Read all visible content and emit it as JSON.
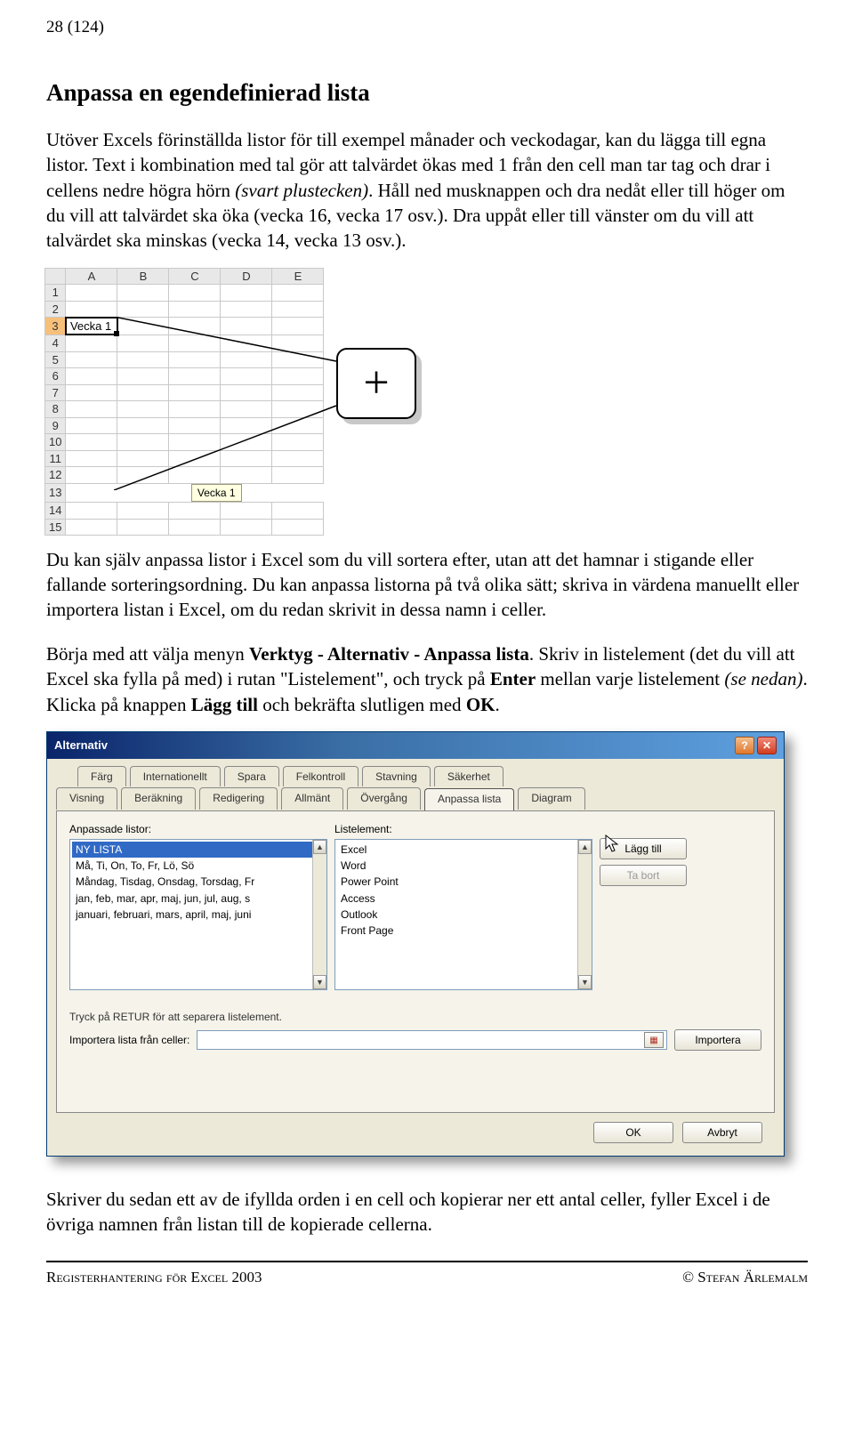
{
  "page_num": "28 (124)",
  "heading": "Anpassa en egendefinierad lista",
  "para1_a": "Utöver Excels förinställda listor för till exempel månader och veckodagar, kan du lägga till egna listor. Text i kombination med tal gör att talvärdet ökas med 1 från den cell man tar tag och drar i cellens nedre högra hörn ",
  "para1_b": "(svart plustecken)",
  "para1_c": ". Håll ned musknappen och dra nedåt eller till höger om du vill att talvärdet ska öka (vecka 16, vecka 17 osv.). Dra uppåt eller till vänster om du vill att talvärdet ska minskas (vecka 14, vecka 13 osv.).",
  "excel": {
    "cols": [
      "A",
      "B",
      "C",
      "D",
      "E"
    ],
    "rows": [
      "1",
      "2",
      "3",
      "4",
      "5",
      "6",
      "7",
      "8",
      "9",
      "10",
      "11",
      "12",
      "13",
      "14",
      "15"
    ],
    "cell_A3": "Vecka 1",
    "tooltip": "Vecka 1"
  },
  "plus": "+",
  "para2": "Du kan själv anpassa listor i Excel som du vill sortera efter, utan att det hamnar i stigande eller fallande sorteringsordning. Du kan anpassa listorna på två olika sätt; skriva in värdena manuellt eller importera listan i Excel, om du redan skrivit in dessa namn i celler.",
  "para3_a": "Börja med att välja menyn ",
  "para3_b": "Verktyg - Alternativ - Anpassa lista",
  "para3_c": ". Skriv in listelement (det du vill att Excel ska fylla på med) i rutan \"Listelement\", och tryck på ",
  "para3_d": "Enter",
  "para3_e": " mellan varje listelement ",
  "para3_f": "(se nedan)",
  "para3_g": ". Klicka på knappen ",
  "para3_h": "Lägg till",
  "para3_i": " och bekräfta slutligen med ",
  "para3_j": "OK",
  "para3_k": ".",
  "dialog": {
    "title": "Alternativ",
    "tabs_top": [
      "Färg",
      "Internationellt",
      "Spara",
      "Felkontroll",
      "Stavning",
      "Säkerhet"
    ],
    "tabs_bottom": [
      "Visning",
      "Beräkning",
      "Redigering",
      "Allmänt",
      "Övergång",
      "Anpassa lista",
      "Diagram"
    ],
    "active_tab": "Anpassa lista",
    "label_left": "Anpassade listor:",
    "label_right": "Listelement:",
    "left_list": [
      "NY LISTA",
      "Må, Ti, On, To, Fr, Lö, Sö",
      "Måndag, Tisdag, Onsdag, Torsdag, Fr",
      "jan, feb, mar, apr, maj, jun, jul, aug, s",
      "januari, februari, mars, april, maj, juni"
    ],
    "right_list": [
      "Excel",
      "Word",
      "Power Point",
      "Access",
      "Outlook",
      "Front Page"
    ],
    "btn_add": "Lägg till",
    "btn_del": "Ta bort",
    "hint": "Tryck på RETUR för att separera listelement.",
    "import_label": "Importera lista från celler:",
    "btn_import": "Importera",
    "btn_ok": "OK",
    "btn_cancel": "Avbryt"
  },
  "para4": "Skriver du sedan ett av de ifyllda orden i en cell och kopierar ner ett antal celler, fyller Excel i de övriga namnen från listan till de kopierade cellerna.",
  "footer_left": "Registerhantering för Excel 2003",
  "footer_right": "© Stefan Ärlemalm"
}
